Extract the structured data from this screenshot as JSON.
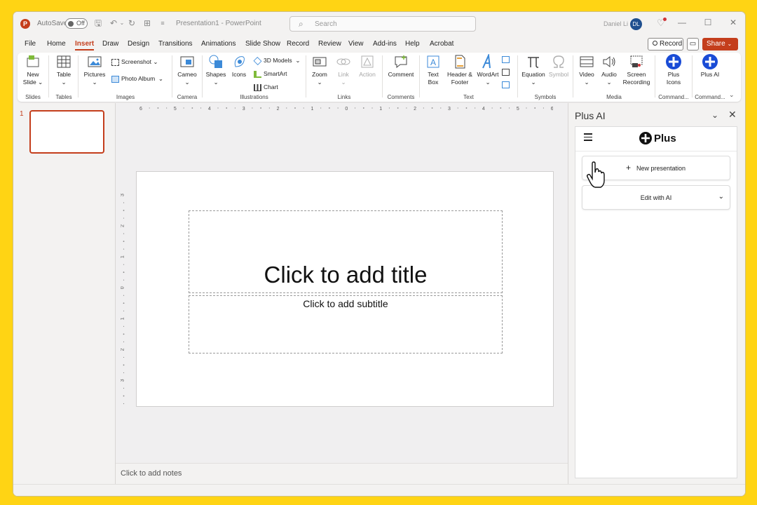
{
  "titlebar": {
    "logo_letter": "P",
    "autosave_label": "AutoSave",
    "autosave_state": "Off",
    "doc_title": "Presentation1 - PowerPoint",
    "search_placeholder": "Search",
    "user_name": "Daniel Li",
    "user_initials": "DL"
  },
  "menu_tabs": [
    "File",
    "Home",
    "Insert",
    "Draw",
    "Design",
    "Transitions",
    "Animations",
    "Slide Show",
    "Record",
    "Review",
    "View",
    "Add-ins",
    "Help",
    "Acrobat"
  ],
  "active_tab": "Insert",
  "header_buttons": {
    "record": "Record",
    "share": "Share"
  },
  "ribbon": {
    "slides": {
      "label": "Slides",
      "new_slide": "New Slide"
    },
    "tables": {
      "label": "Tables",
      "table": "Table"
    },
    "images": {
      "label": "Images",
      "pictures": "Pictures",
      "screenshot": "Screenshot",
      "photo_album": "Photo Album"
    },
    "camera": {
      "label": "Camera",
      "cameo": "Cameo"
    },
    "illustrations": {
      "label": "Illustrations",
      "shapes": "Shapes",
      "icons": "Icons",
      "models": "3D Models",
      "smartart": "SmartArt",
      "chart": "Chart"
    },
    "links": {
      "label": "Links",
      "zoom": "Zoom",
      "link": "Link",
      "action": "Action"
    },
    "comments": {
      "label": "Comments",
      "comment": "Comment"
    },
    "text": {
      "label": "Text",
      "text_box": "Text Box",
      "header_footer": "Header & Footer",
      "wordart": "WordArt"
    },
    "symbols": {
      "label": "Symbols",
      "equation": "Equation",
      "symbol": "Symbol"
    },
    "media": {
      "label": "Media",
      "video": "Video",
      "audio": "Audio",
      "screen_recording": "Screen Recording"
    },
    "commands1": {
      "label": "Command...",
      "plus_icons": "Plus Icons"
    },
    "commands2": {
      "label": "Command...",
      "plus_ai": "Plus AI"
    }
  },
  "thumbnails": {
    "slide_number": "1"
  },
  "rulers": {
    "horizontal": [
      "6",
      "5",
      "4",
      "3",
      "2",
      "1",
      "0",
      "1",
      "2",
      "3",
      "4",
      "5",
      "6"
    ],
    "vertical": [
      "3",
      "2",
      "1",
      "0",
      "1",
      "2",
      "3"
    ]
  },
  "slide": {
    "title_placeholder": "Click to add title",
    "subtitle_placeholder": "Click to add subtitle"
  },
  "notes": {
    "placeholder": "Click to add notes"
  },
  "addin_pane": {
    "title": "Plus AI",
    "brand": "Plus",
    "new_presentation": "New presentation",
    "edit_with_ai": "Edit with AI"
  },
  "colors": {
    "accent": "#c43e1c",
    "plus_blue": "#1a4cd6",
    "frame_yellow": "#FFD414"
  }
}
